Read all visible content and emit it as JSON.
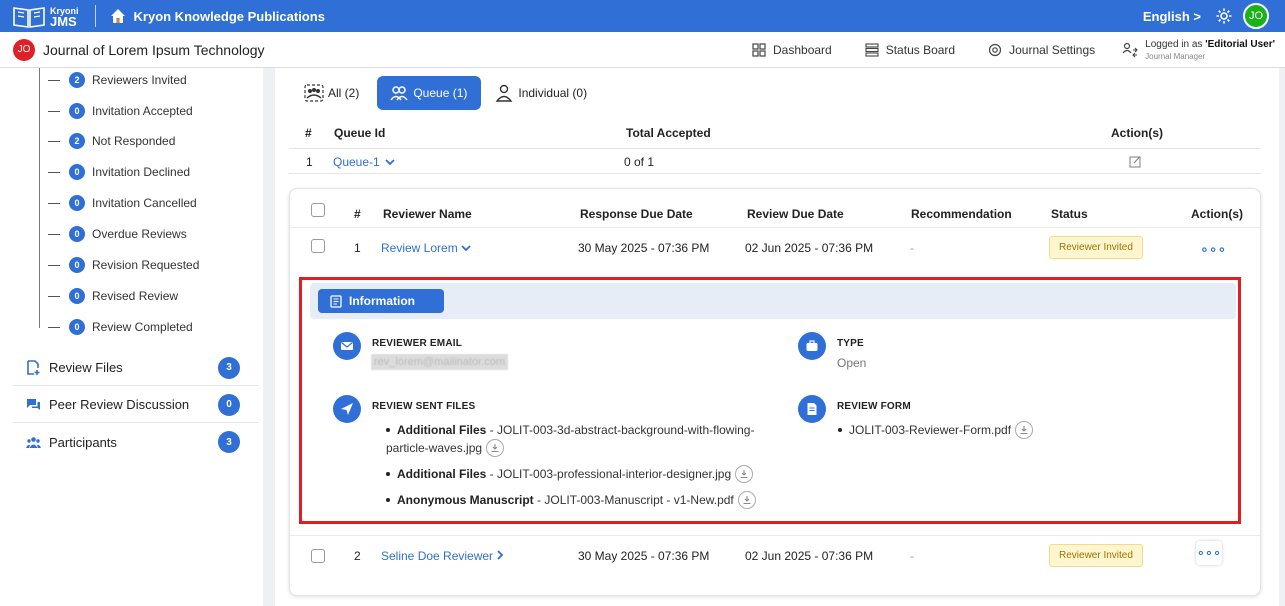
{
  "topbar": {
    "logo_line1": "Kryoni",
    "logo_line2": "JMS",
    "publication": "Kryon Knowledge Publications",
    "language": "English >",
    "avatar": "JO"
  },
  "subbar": {
    "journal_badge": "JO",
    "journal_name": "Journal of Lorem Ipsum Technology",
    "nav": [
      "Dashboard",
      "Status Board",
      "Journal Settings"
    ],
    "login_prefix": "Logged in as ",
    "login_user": "'Editorial User'",
    "login_role": "Journal Manager"
  },
  "sidebar": {
    "sub_items": [
      {
        "count": "2",
        "label": "Reviewers Invited"
      },
      {
        "count": "0",
        "label": "Invitation Accepted"
      },
      {
        "count": "2",
        "label": "Not Responded"
      },
      {
        "count": "0",
        "label": "Invitation Declined"
      },
      {
        "count": "0",
        "label": "Invitation Cancelled"
      },
      {
        "count": "0",
        "label": "Overdue Reviews"
      },
      {
        "count": "0",
        "label": "Revision Requested"
      },
      {
        "count": "0",
        "label": "Revised Review"
      },
      {
        "count": "0",
        "label": "Review Completed"
      }
    ],
    "main_items": [
      {
        "label": "Review Files",
        "count": "3"
      },
      {
        "label": "Peer Review Discussion",
        "count": "0"
      },
      {
        "label": "Participants",
        "count": "3"
      }
    ]
  },
  "tabs": [
    "All (2)",
    "Queue (1)",
    "Individual (0)"
  ],
  "queue_table": {
    "headers": [
      "#",
      "Queue Id",
      "Total Accepted",
      "Action(s)"
    ],
    "row": {
      "num": "1",
      "queue_id": "Queue-1",
      "accepted": "0 of 1"
    }
  },
  "reviewer_table": {
    "headers": [
      "#",
      "Reviewer Name",
      "Response Due Date",
      "Review Due Date",
      "Recommendation",
      "Status",
      "Action(s)"
    ],
    "rows": [
      {
        "num": "1",
        "name": "Review Lorem",
        "response_due": "30 May 2025 - 07:36 PM",
        "review_due": "02 Jun 2025 - 07:36 PM",
        "recommendation": "-",
        "status": "Reviewer Invited"
      },
      {
        "num": "2",
        "name": "Seline Doe Reviewer",
        "response_due": "30 May 2025 - 07:36 PM",
        "review_due": "02 Jun 2025 - 07:36 PM",
        "recommendation": "-",
        "status": "Reviewer Invited"
      }
    ]
  },
  "information": {
    "tab_label": "Information",
    "email_label": "REVIEWER EMAIL",
    "email_value": "rev_lorem@mailinator.com",
    "type_label": "TYPE",
    "type_value": "Open",
    "sent_files_label": "REVIEW SENT FILES",
    "sent_files": [
      {
        "kind": "Additional Files",
        "name_line1": "JOLIT-003-3d-abstract-background-with-flowing-",
        "name_line2": "particle-waves.jpg"
      },
      {
        "kind": "Additional Files",
        "name_line1": "JOLIT-003-professional-interior-designer.jpg"
      },
      {
        "kind": "Anonymous Manuscript",
        "name_line1": "JOLIT-003-Manuscript - v1-New.pdf"
      }
    ],
    "review_form_label": "REVIEW FORM",
    "review_form_file": "JOLIT-003-Reviewer-Form.pdf",
    "separator": " - "
  },
  "colors": {
    "accent": "#2f6fd6",
    "highlight_border": "#e01e26",
    "status_bg": "#fff6cf"
  }
}
